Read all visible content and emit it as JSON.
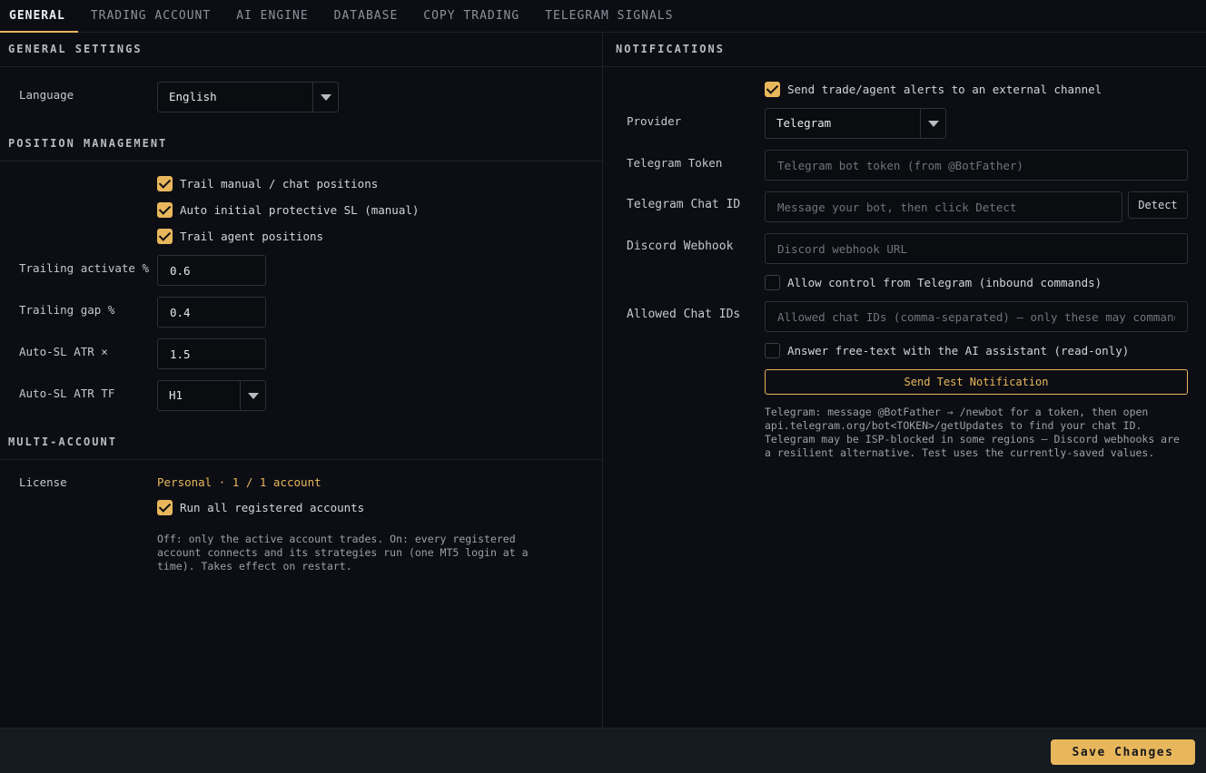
{
  "tabs": [
    "GENERAL",
    "TRADING ACCOUNT",
    "AI ENGINE",
    "DATABASE",
    "COPY TRADING",
    "TELEGRAM SIGNALS"
  ],
  "colors": {
    "accent": "#e8b75c",
    "background": "#0c0e13"
  },
  "general": {
    "title": "GENERAL SETTINGS",
    "language_label": "Language",
    "language_value": "English"
  },
  "position": {
    "title": "POSITION MANAGEMENT",
    "trail_manual": {
      "label": "Trail manual / chat positions",
      "checked": true
    },
    "auto_sl": {
      "label": "Auto initial protective SL (manual)",
      "checked": true
    },
    "trail_agent": {
      "label": "Trail agent positions",
      "checked": true
    },
    "trailing_activate_label": "Trailing activate %",
    "trailing_activate_value": "0.6",
    "trailing_gap_label": "Trailing gap %",
    "trailing_gap_value": "0.4",
    "atr_mult_label": "Auto-SL ATR ×",
    "atr_mult_value": "1.5",
    "atr_tf_label": "Auto-SL ATR TF",
    "atr_tf_value": "H1"
  },
  "multi": {
    "title": "MULTI-ACCOUNT",
    "license_label": "License",
    "license_value": "Personal · 1 / 1 account",
    "run_all": {
      "label": "Run all registered accounts",
      "checked": true
    },
    "help": "Off: only the active account trades. On: every registered account connects and its strategies run (one MT5 login at a time). Takes effect on restart."
  },
  "notifications": {
    "title": "NOTIFICATIONS",
    "send_alerts": {
      "label": "Send trade/agent alerts to an external channel",
      "checked": true
    },
    "provider_label": "Provider",
    "provider_value": "Telegram",
    "token_label": "Telegram Token",
    "token_placeholder": "Telegram bot token (from @BotFather)",
    "chat_id_label": "Telegram Chat ID",
    "chat_id_placeholder": "Message your bot, then click Detect",
    "detect_label": "Detect",
    "discord_label": "Discord Webhook",
    "discord_placeholder": "Discord webhook URL",
    "allow_control": {
      "label": "Allow control from Telegram (inbound commands)",
      "checked": false
    },
    "allowed_label": "Allowed Chat IDs",
    "allowed_placeholder": "Allowed chat IDs (comma-separated) — only these may command",
    "answer_free": {
      "label": "Answer free-text with the AI assistant (read-only)",
      "checked": false
    },
    "test_button": "Send Test Notification",
    "help": "Telegram: message @BotFather → /newbot for a token, then open api.telegram.org/bot<TOKEN>/getUpdates to find your chat ID. Telegram may be ISP-blocked in some regions — Discord webhooks are a resilient alternative. Test uses the currently-saved values."
  },
  "footer": {
    "save_label": "Save Changes"
  }
}
